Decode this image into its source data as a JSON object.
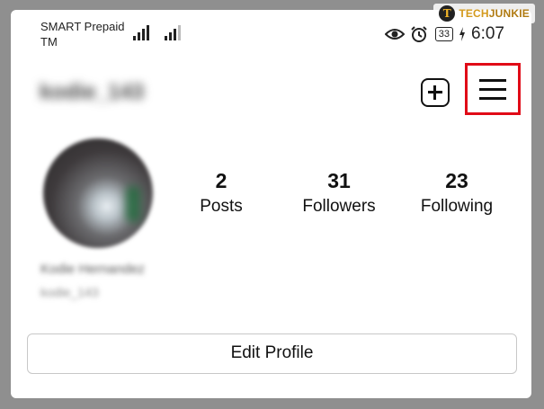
{
  "status_bar": {
    "carrier_line1": "SMART Prepaid",
    "carrier_line2": "TM",
    "battery": "33",
    "time": "6:07",
    "icons": [
      "signal-icon",
      "signal-icon",
      "eye-icon",
      "alarm-icon",
      "battery-icon",
      "charging-icon"
    ]
  },
  "watermark": {
    "badge": "T",
    "text_prefix": "TECH",
    "text_suffix": "JUNKIE"
  },
  "header": {
    "username": "kodie_143",
    "add_icon": "add-square-icon",
    "menu_icon": "hamburger-menu-icon",
    "highlight_color": "#e00b17"
  },
  "profile": {
    "display_name": "Kodie Hernandez",
    "handle": "kodie_143",
    "stats": [
      {
        "value": "2",
        "label": "Posts"
      },
      {
        "value": "31",
        "label": "Followers"
      },
      {
        "value": "23",
        "label": "Following"
      }
    ],
    "edit_button": "Edit Profile"
  }
}
